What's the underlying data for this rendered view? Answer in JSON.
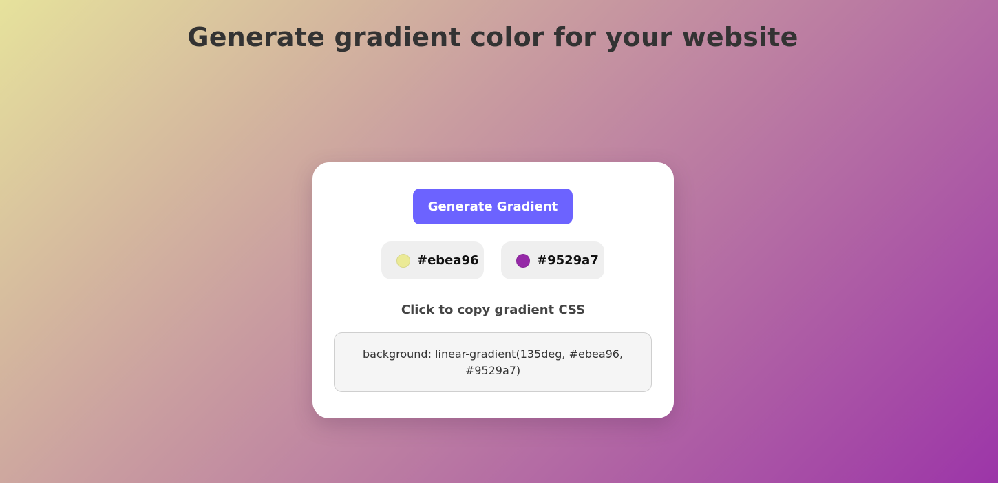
{
  "header": {
    "title": "Generate gradient color for your website"
  },
  "card": {
    "generate_label": "Generate Gradient",
    "colors": [
      {
        "hex": "#ebea96",
        "swatch_color": "#ebea96"
      },
      {
        "hex": "#9529a7",
        "swatch_color": "#9529a7"
      }
    ],
    "copy_label": "Click to copy gradient CSS",
    "css_text": "background: linear-gradient(135deg, #ebea96, #9529a7)"
  }
}
